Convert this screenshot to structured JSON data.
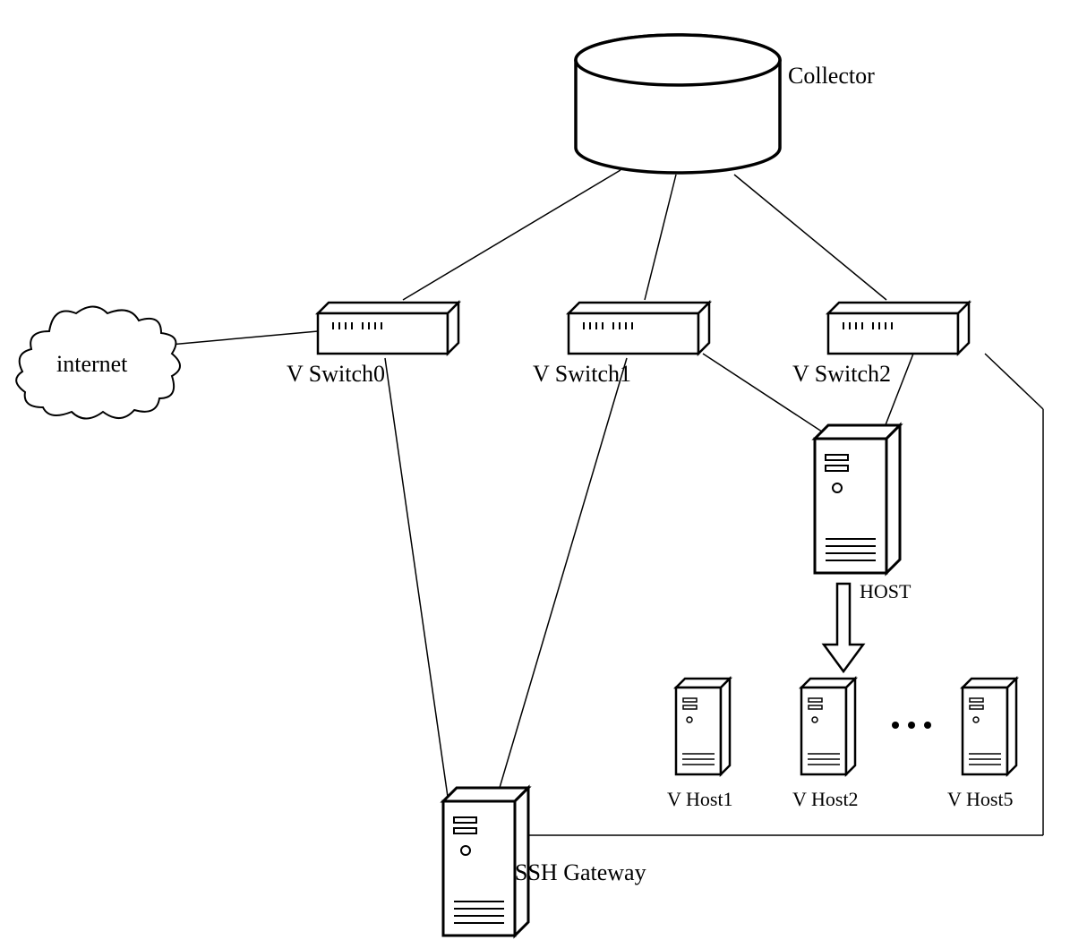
{
  "nodes": {
    "collector": {
      "label": "Collector"
    },
    "internet": {
      "label": "internet"
    },
    "vswitch0": {
      "label": "V Switch0"
    },
    "vswitch1": {
      "label": "V Switch1"
    },
    "vswitch2": {
      "label": "V Switch2"
    },
    "host": {
      "label": "HOST"
    },
    "vhost1": {
      "label": "V Host1"
    },
    "vhost2": {
      "label": "V Host2"
    },
    "vhost5": {
      "label": "V Host5"
    },
    "sshgateway": {
      "label": "SSH Gateway"
    },
    "ellipsis": {
      "label": "•••"
    }
  },
  "connections": [
    {
      "from": "collector",
      "to": "vswitch0"
    },
    {
      "from": "collector",
      "to": "vswitch1"
    },
    {
      "from": "collector",
      "to": "vswitch2"
    },
    {
      "from": "internet",
      "to": "vswitch0"
    },
    {
      "from": "vswitch0",
      "to": "sshgateway"
    },
    {
      "from": "vswitch1",
      "to": "sshgateway"
    },
    {
      "from": "vswitch1",
      "to": "host"
    },
    {
      "from": "vswitch2",
      "to": "host"
    },
    {
      "from": "vswitch2",
      "to": "sshgateway",
      "routed": true
    },
    {
      "from": "host",
      "to": "vhost2",
      "arrow": true
    }
  ]
}
